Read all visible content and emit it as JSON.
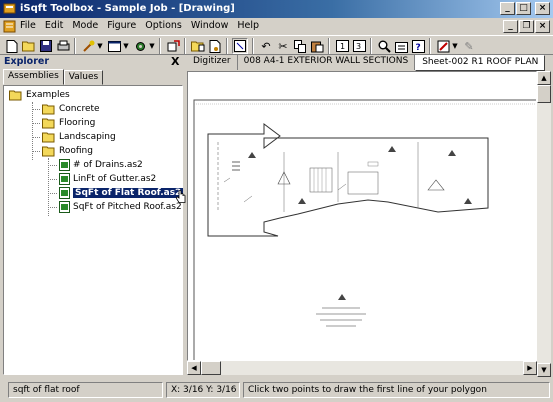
{
  "window": {
    "title": "iSqft Toolbox - Sample Job - [Drawing]"
  },
  "menu": {
    "items": [
      "File",
      "Edit",
      "Mode",
      "Figure",
      "Options",
      "Window",
      "Help"
    ]
  },
  "explorer": {
    "title": "Explorer",
    "close": "X",
    "tabs": [
      "Assemblies",
      "Values"
    ],
    "tree": {
      "root": "Examples",
      "folders": [
        "Concrete",
        "Flooring",
        "Landscaping",
        "Roofing"
      ],
      "roofing_items": [
        "# of Drains.as2",
        "LinFt of Gutter.as2",
        "SqFt of Flat Roof.as2",
        "SqFt of Pitched Roof.as2"
      ]
    }
  },
  "doc_tabs": [
    "Digitizer",
    "008 A4-1 EXTERIOR WALL SECTIONS",
    "Sheet-002 R1 ROOF PLAN"
  ],
  "status": {
    "left": "sqft of flat roof",
    "coords": "X: 3/16  Y: 3/16",
    "message": "Click two points to draw the first line of your polygon"
  },
  "colors": {
    "title_bar": "#0a246a",
    "selection": "#0a246a",
    "folder": "#f3d85a"
  }
}
